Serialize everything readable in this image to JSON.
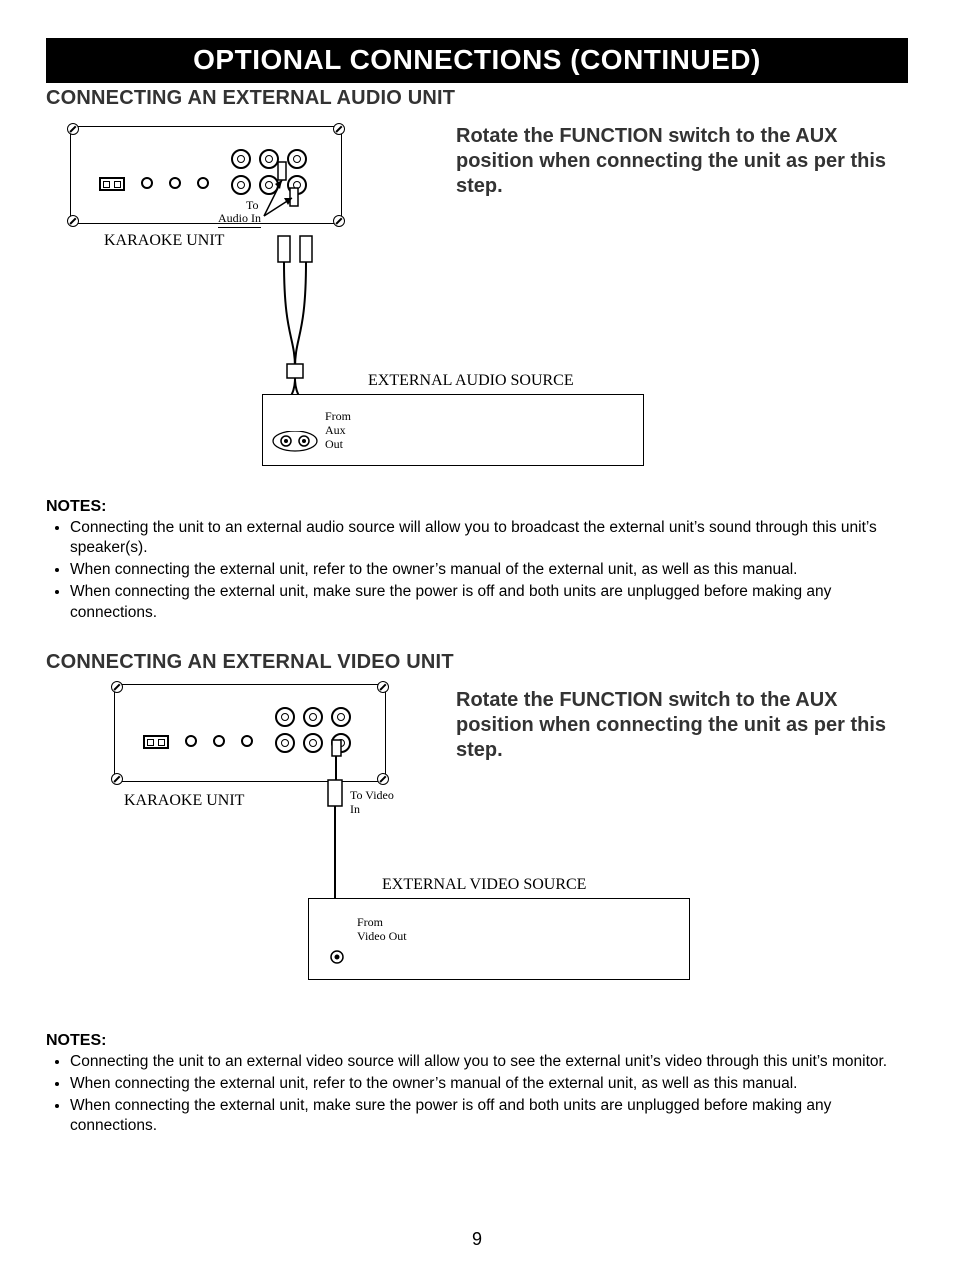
{
  "header": "OPTIONAL CONNECTIONS (CONTINUED)",
  "page_number": "9",
  "section_audio": {
    "title": "CONNECTING AN EXTERNAL AUDIO UNIT",
    "instruction": "Rotate the FUNCTION switch to the AUX position when connecting the unit as per this step.",
    "diagram": {
      "unit_label": "KARAOKE UNIT",
      "to_audio_in": "To",
      "to_audio_in_2": "Audio In",
      "ext_label": "EXTERNAL AUDIO SOURCE",
      "from_label_1": "From",
      "from_label_2": "Aux",
      "from_label_3": "Out"
    },
    "notes_title": "NOTES:",
    "notes": [
      "Connecting the unit to an external audio source will allow you to broadcast the external unit’s sound through this unit’s speaker(s).",
      "When connecting the external unit, refer to the owner’s manual of the external unit, as well as this manual.",
      "When connecting the external unit, make sure the power is off and both units are unplugged before making any connections."
    ]
  },
  "section_video": {
    "title": "CONNECTING AN EXTERNAL VIDEO UNIT",
    "instruction": "Rotate the FUNCTION switch to the AUX position when connecting the unit as per this step.",
    "diagram": {
      "unit_label": "KARAOKE UNIT",
      "to_video_1": "To Video",
      "to_video_2": "In",
      "ext_label": "EXTERNAL VIDEO SOURCE",
      "from_label_1": "From",
      "from_label_2": "Video Out"
    },
    "notes_title": "NOTES:",
    "notes": [
      "Connecting the unit to an external video source will allow you to see the external unit’s video through this unit’s monitor.",
      "When connecting the external unit, refer to the owner’s manual of the external unit, as well as this manual.",
      "When connecting the external unit, make sure the power is off and both units are unplugged before making any connections."
    ]
  }
}
